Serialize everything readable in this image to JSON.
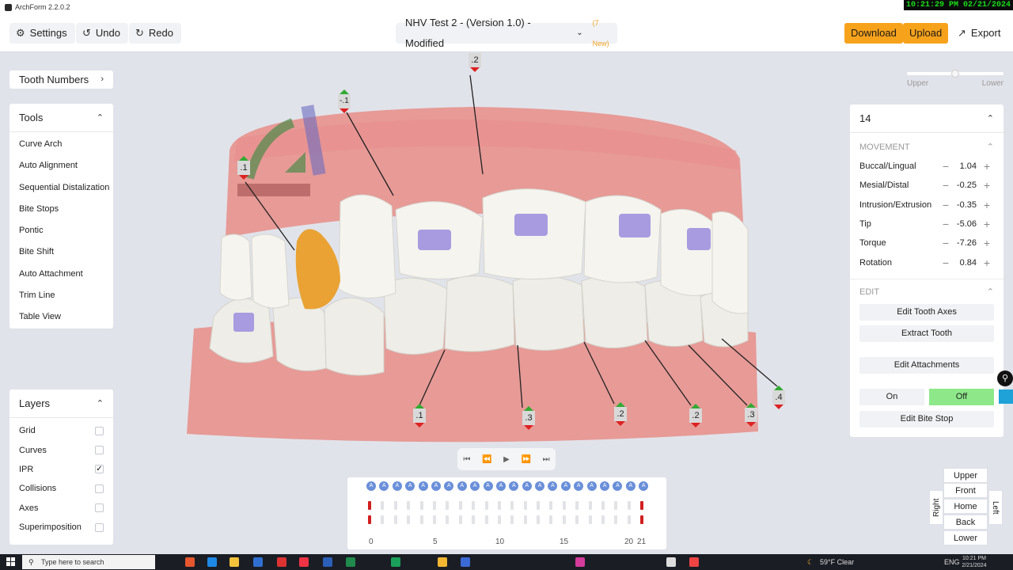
{
  "window": {
    "title": "ArchForm 2.2.0.2",
    "clock": "10:21:29 PM 02/21/2024"
  },
  "toolbar": {
    "settings": "Settings",
    "undo": "Undo",
    "redo": "Redo",
    "doc_title": "NHV Test 2 - (Version 1.0) - Modified",
    "new_badge": "(7 New)",
    "download": "Download",
    "upload": "Upload",
    "export": "Export"
  },
  "tooth_numbers": {
    "label": "Tooth Numbers"
  },
  "tools": {
    "title": "Tools",
    "items": [
      "Curve Arch",
      "Auto Alignment",
      "Sequential Distalization",
      "Bite Stops",
      "Pontic",
      "Bite Shift",
      "Auto Attachment",
      "Trim Line",
      "Table View"
    ]
  },
  "layers": {
    "title": "Layers",
    "items": [
      {
        "label": "Grid",
        "checked": false
      },
      {
        "label": "Curves",
        "checked": false
      },
      {
        "label": "IPR",
        "checked": true
      },
      {
        "label": "Collisions",
        "checked": false
      },
      {
        "label": "Axes",
        "checked": false
      },
      {
        "label": "Superimposition",
        "checked": false
      }
    ]
  },
  "arch_slider": {
    "upper": "Upper",
    "lower": "Lower"
  },
  "tooth_panel": {
    "tooth": "14",
    "movement_title": "MOVEMENT",
    "movements": [
      {
        "label": "Buccal/Lingual",
        "value": "1.04"
      },
      {
        "label": "Mesial/Distal",
        "value": "-0.25"
      },
      {
        "label": "Intrusion/Extrusion",
        "value": "-0.35"
      },
      {
        "label": "Tip",
        "value": "-5.06"
      },
      {
        "label": "Torque",
        "value": "-7.26"
      },
      {
        "label": "Rotation",
        "value": "0.84"
      }
    ],
    "edit_title": "EDIT",
    "edit_axes": "Edit Tooth Axes",
    "extract": "Extract Tooth",
    "edit_attachments": "Edit Attachments",
    "on": "On",
    "off": "Off",
    "edit_bite_stop": "Edit Bite Stop"
  },
  "ipr_labels": {
    "top": ".2",
    "upper_left": "-.1",
    "left": ".1",
    "l1": ".1",
    "l2": ".3",
    "l3": ".2",
    "l4": ".2",
    "l5": ".3",
    "l6": ".4"
  },
  "stages": {
    "dot_label": "A",
    "dot_count": 22,
    "axis": [
      "0",
      "5",
      "10",
      "15",
      "20",
      "21"
    ]
  },
  "view_cube": {
    "upper": "Upper",
    "front": "Front",
    "home": "Home",
    "back": "Back",
    "lower": "Lower",
    "right": "Right",
    "left": "Left"
  },
  "taskbar": {
    "search": "Type here to search",
    "weather": "59°F Clear",
    "lang": "ENG",
    "time": "10:21 PM",
    "date": "2/21/2024"
  },
  "colors": {
    "accent": "#f7a21b",
    "gum": "#e79a96",
    "tooth": "#f2f1ec",
    "attachment": "#a99be0",
    "selected_tooth": "#e9a233",
    "off_active": "#8ee88a"
  }
}
